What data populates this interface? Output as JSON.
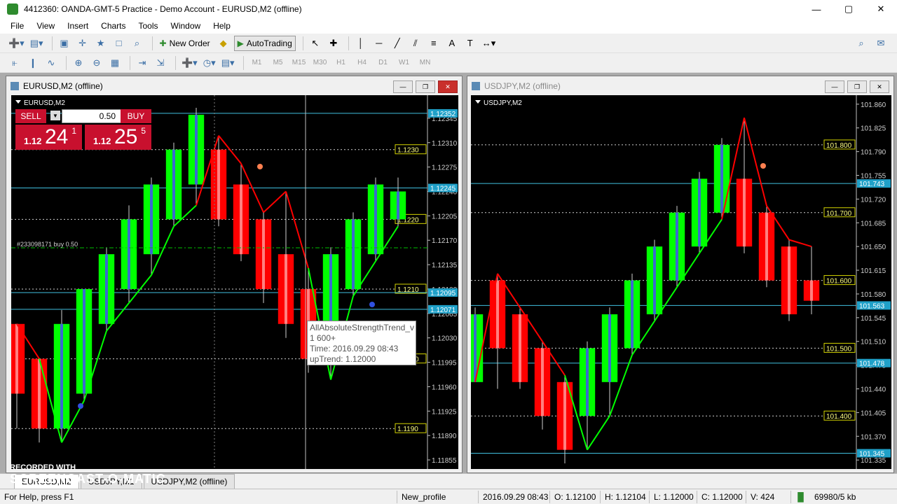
{
  "window": {
    "title": "4412360: OANDA-GMT-5 Practice - Demo Account - EURUSD,M2 (offline)"
  },
  "menu": [
    "File",
    "View",
    "Insert",
    "Charts",
    "Tools",
    "Window",
    "Help"
  ],
  "toolbar": {
    "new_order": "New Order",
    "auto_trading": "AutoTrading",
    "periods": [
      "M1",
      "M5",
      "M15",
      "M30",
      "H1",
      "H4",
      "D1",
      "W1",
      "MN"
    ]
  },
  "chart1": {
    "window_title": "EURUSD,M2 (offline)",
    "symbol_label": "EURUSD,M2",
    "trade_panel": {
      "sell": "SELL",
      "buy": "BUY",
      "lot": "0.50",
      "bid_prefix": "1.12",
      "bid_big": "24",
      "bid_small": "1",
      "ask_prefix": "1.12",
      "ask_big": "25",
      "ask_small": "5"
    },
    "order_label": "#233098171 buy 0.50",
    "tooltip": [
      "AllAbsoluteStrengthTrend_v",
      "1 600+",
      "Time: 2016.09.29 08:43",
      "upTrend: 1.12000"
    ]
  },
  "chart2": {
    "window_title": "USDJPY,M2 (offline)",
    "symbol_label": "USDJPY,M2"
  },
  "tabs": [
    "EURUSD,M2",
    "USDJPY,M1",
    "USDJPY,M2 (offline)"
  ],
  "status": {
    "help": "For Help, press F1",
    "profile": "New_profile",
    "time": "2016.09.29 08:43",
    "open": "O: 1.12100",
    "high": "H: 1.12104",
    "low": "L: 1.12000",
    "close": "C: 1.12000",
    "volume": "V: 424",
    "traffic": "69980/5 kb"
  },
  "watermark": {
    "recorded": "RECORDED WITH",
    "brand": "SCREENCAST-O-MATIC"
  },
  "colors": {
    "bull": "#00ff00",
    "bear": "#ff0000",
    "grid": "#7f7f7f",
    "level": "#ffff80",
    "cyan": "#40c0e0"
  },
  "chart_data": [
    {
      "type": "candlestick",
      "symbol": "EURUSD,M2",
      "y_ticks": [
        "1.12345",
        "1.12310",
        "1.12275",
        "1.12240",
        "1.12205",
        "1.12170",
        "1.12135",
        "1.12100",
        "1.12065",
        "1.12030",
        "1.11995",
        "1.11960",
        "1.11925",
        "1.11890",
        "1.11855"
      ],
      "ylim": [
        1.1185,
        1.1237
      ],
      "level_labels": [
        "1.1230",
        "1.1220",
        "1.1210",
        "1.1200",
        "1.1190"
      ],
      "price_marks": [
        "1.12352",
        "1.12245",
        "1.12095",
        "1.12071"
      ],
      "candles": [
        {
          "o": 1.1205,
          "c": 1.1195,
          "h": 1.1205,
          "l": 1.119
        },
        {
          "o": 1.12,
          "c": 1.119,
          "h": 1.12,
          "l": 1.1188
        },
        {
          "o": 1.119,
          "c": 1.1205,
          "h": 1.1207,
          "l": 1.1188
        },
        {
          "o": 1.1195,
          "c": 1.121,
          "h": 1.121,
          "l": 1.1194
        },
        {
          "o": 1.1205,
          "c": 1.1215,
          "h": 1.1216,
          "l": 1.1204
        },
        {
          "o": 1.121,
          "c": 1.122,
          "h": 1.1222,
          "l": 1.1208
        },
        {
          "o": 1.1215,
          "c": 1.1225,
          "h": 1.1226,
          "l": 1.1212
        },
        {
          "o": 1.122,
          "c": 1.123,
          "h": 1.1231,
          "l": 1.1219
        },
        {
          "o": 1.1225,
          "c": 1.1235,
          "h": 1.1236,
          "l": 1.1222
        },
        {
          "o": 1.123,
          "c": 1.122,
          "h": 1.1232,
          "l": 1.1219
        },
        {
          "o": 1.1225,
          "c": 1.1215,
          "h": 1.1228,
          "l": 1.1214
        },
        {
          "o": 1.122,
          "c": 1.121,
          "h": 1.1221,
          "l": 1.1208
        },
        {
          "o": 1.1215,
          "c": 1.1205,
          "h": 1.1224,
          "l": 1.1203
        },
        {
          "o": 1.121,
          "c": 1.12,
          "h": 1.1213,
          "l": 1.1198
        },
        {
          "o": 1.1205,
          "c": 1.1215,
          "h": 1.1216,
          "l": 1.1197
        },
        {
          "o": 1.121,
          "c": 1.122,
          "h": 1.1221,
          "l": 1.1209
        },
        {
          "o": 1.1215,
          "c": 1.1225,
          "h": 1.1226,
          "l": 1.1214
        },
        {
          "o": 1.122,
          "c": 1.1224,
          "h": 1.1226,
          "l": 1.1219
        }
      ]
    },
    {
      "type": "candlestick",
      "symbol": "USDJPY,M2",
      "y_ticks": [
        "101.860",
        "101.825",
        "101.790",
        "101.755",
        "101.720",
        "101.685",
        "101.650",
        "101.615",
        "101.580",
        "101.545",
        "101.510",
        "101.475",
        "101.440",
        "101.405",
        "101.370",
        "101.335"
      ],
      "ylim": [
        101.33,
        101.865
      ],
      "level_labels": [
        "101.800",
        "101.700",
        "101.600",
        "101.500",
        "101.400"
      ],
      "price_marks": [
        "101.743",
        "101.563",
        "101.478",
        "101.345"
      ],
      "candles": [
        {
          "o": 101.45,
          "c": 101.55,
          "h": 101.56,
          "l": 101.45
        },
        {
          "o": 101.6,
          "c": 101.5,
          "h": 101.61,
          "l": 101.44
        },
        {
          "o": 101.55,
          "c": 101.45,
          "h": 101.56,
          "l": 101.44
        },
        {
          "o": 101.5,
          "c": 101.4,
          "h": 101.51,
          "l": 101.38
        },
        {
          "o": 101.45,
          "c": 101.35,
          "h": 101.46,
          "l": 101.33
        },
        {
          "o": 101.4,
          "c": 101.5,
          "h": 101.51,
          "l": 101.35
        },
        {
          "o": 101.45,
          "c": 101.55,
          "h": 101.56,
          "l": 101.4
        },
        {
          "o": 101.5,
          "c": 101.6,
          "h": 101.61,
          "l": 101.49
        },
        {
          "o": 101.55,
          "c": 101.65,
          "h": 101.66,
          "l": 101.54
        },
        {
          "o": 101.6,
          "c": 101.7,
          "h": 101.71,
          "l": 101.59
        },
        {
          "o": 101.65,
          "c": 101.75,
          "h": 101.76,
          "l": 101.64
        },
        {
          "o": 101.7,
          "c": 101.8,
          "h": 101.81,
          "l": 101.69
        },
        {
          "o": 101.75,
          "c": 101.65,
          "h": 101.84,
          "l": 101.64
        },
        {
          "o": 101.7,
          "c": 101.6,
          "h": 101.71,
          "l": 101.59
        },
        {
          "o": 101.65,
          "c": 101.55,
          "h": 101.66,
          "l": 101.54
        },
        {
          "o": 101.6,
          "c": 101.57,
          "h": 101.65,
          "l": 101.55
        }
      ]
    }
  ]
}
